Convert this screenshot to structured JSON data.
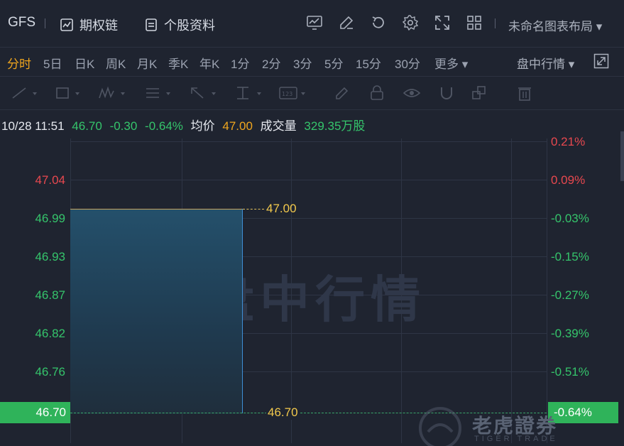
{
  "header": {
    "ticker": "GFS",
    "options_chain": "期权链",
    "stock_profile": "个股资料",
    "layout_name": "未命名图表布局 ▾"
  },
  "icons": [
    "chart-icon",
    "edit-icon",
    "refresh-icon",
    "settings-icon",
    "expand-icon",
    "grid-icon"
  ],
  "periods": [
    "分时",
    "5日",
    "日K",
    "周K",
    "月K",
    "季K",
    "年K",
    "1分",
    "2分",
    "3分",
    "5分",
    "15分",
    "30分",
    "更多 ▾"
  ],
  "active_period": "分时",
  "quote_selector": "盘中行情 ▾",
  "info": {
    "datetime": "10/28 11:51",
    "price": "46.70",
    "change": "-0.30",
    "change_pct": "-0.64%",
    "avg_label": "均价",
    "avg_value": "47.00",
    "volume_label": "成交量",
    "volume_value": "329.35万股"
  },
  "axis_left": [
    "47.04",
    "46.99",
    "46.93",
    "46.87",
    "46.82",
    "46.76"
  ],
  "axis_right": [
    "0.21%",
    "0.09%",
    "-0.03%",
    "-0.15%",
    "-0.27%",
    "-0.39%",
    "-0.51%"
  ],
  "current_left": "46.70",
  "current_right": "-0.64%",
  "avg_marker": "47.00",
  "current_marker": "46.70",
  "watermark": "盘中行情",
  "brand": {
    "name": "老虎證券",
    "sub": "TIGER TRADE"
  },
  "colors": {
    "up": "#e8484f",
    "down": "#35c46b",
    "accent": "#f0a61e",
    "avg": "#f2c94c"
  }
}
